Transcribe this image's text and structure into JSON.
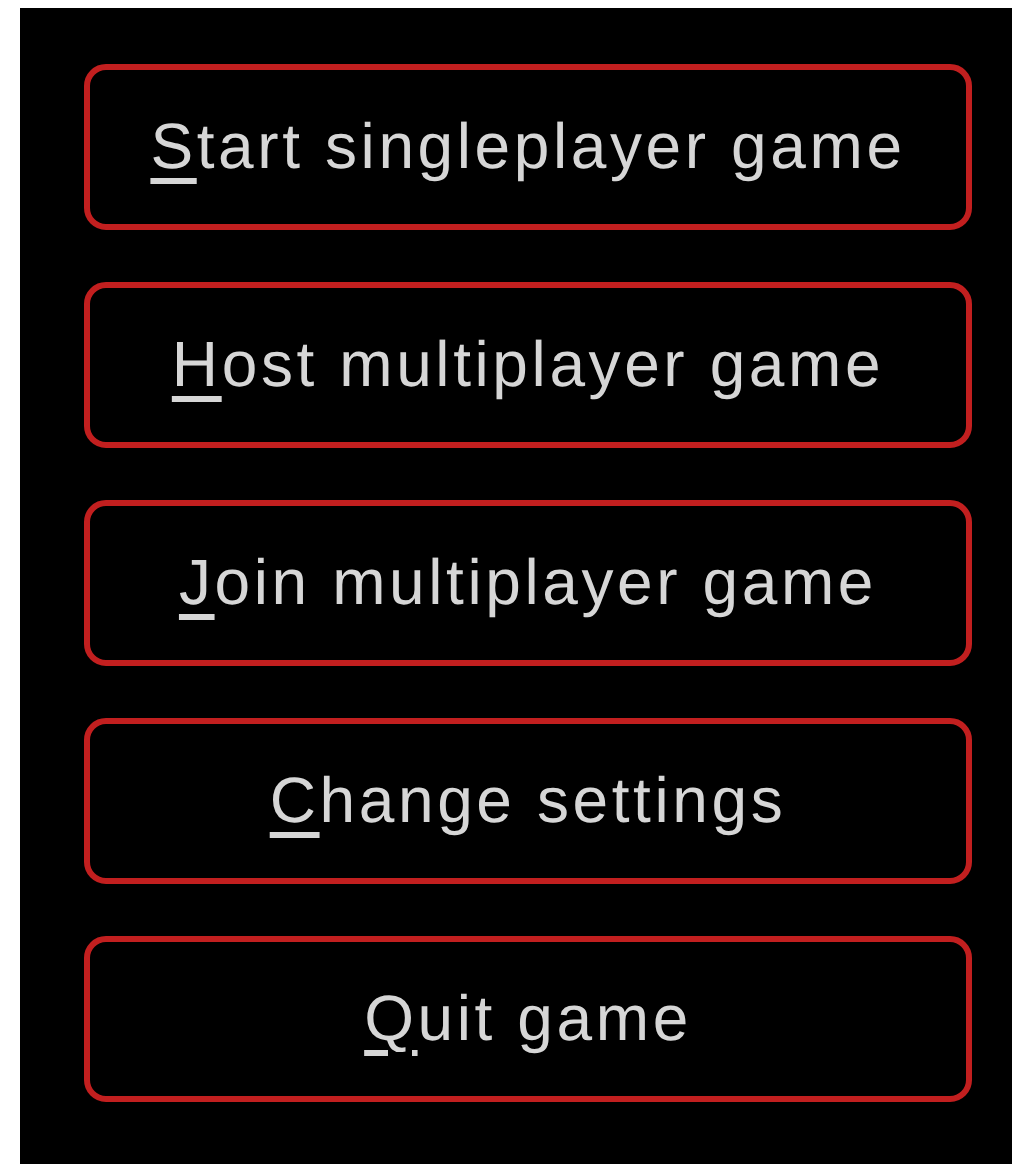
{
  "menu": {
    "buttons": [
      {
        "key": "S",
        "rest": "tart singleplayer game"
      },
      {
        "key": "H",
        "rest": "ost multiplayer game"
      },
      {
        "key": "J",
        "rest": "oin multiplayer game"
      },
      {
        "key": "C",
        "rest": "hange settings"
      },
      {
        "key": "Q",
        "rest": "uit game"
      }
    ]
  }
}
